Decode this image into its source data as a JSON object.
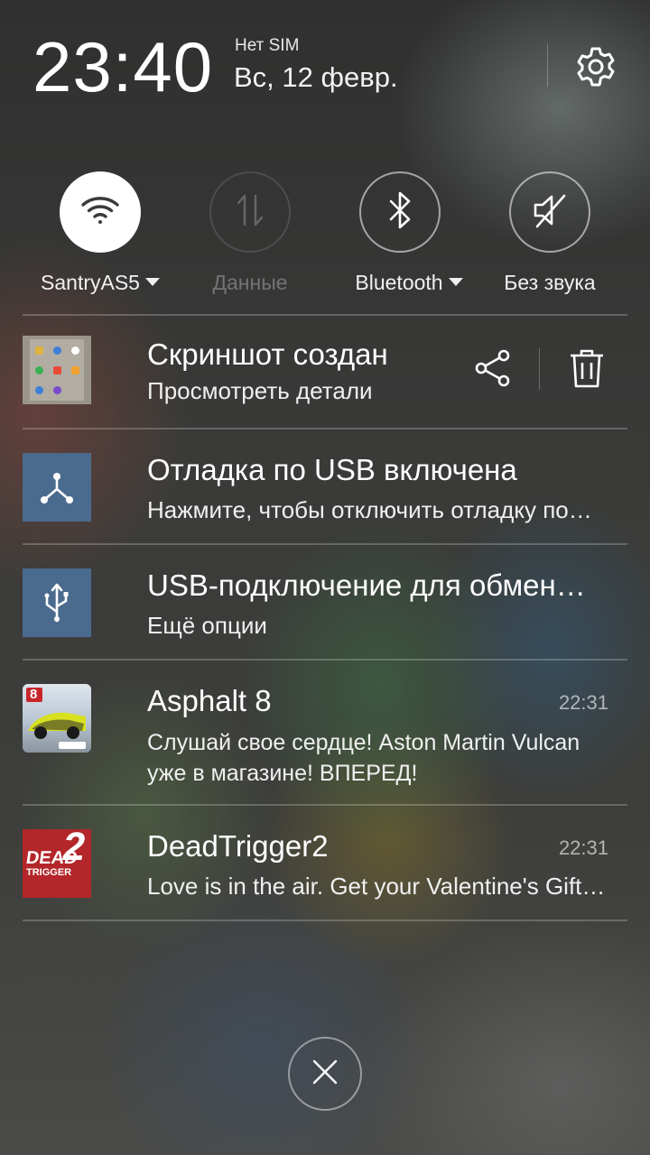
{
  "header": {
    "time": "23:40",
    "sim_status": "Нет SIM",
    "date": "Вс, 12 февр."
  },
  "toggles": [
    {
      "label": "SantryAS5",
      "icon": "wifi-icon",
      "state": "on",
      "has_menu": true
    },
    {
      "label": "Данные",
      "icon": "data-transfer-icon",
      "state": "disabled",
      "has_menu": false
    },
    {
      "label": "Bluetooth",
      "icon": "bluetooth-icon",
      "state": "off",
      "has_menu": true
    },
    {
      "label": "Без звука",
      "icon": "mute-icon",
      "state": "off",
      "has_menu": false
    }
  ],
  "notifications": [
    {
      "id": "screenshot",
      "title": "Скриншот создан",
      "subtitle": "Просмотреть детали",
      "actions": [
        "share-icon",
        "trash-icon"
      ]
    },
    {
      "id": "usb-debug",
      "title": "Отладка по USB включена",
      "subtitle": "Нажмите, чтобы отключить отладку по USB."
    },
    {
      "id": "usb-connection",
      "title": "USB-подключение для обмена файлами",
      "subtitle": "Ещё опции"
    },
    {
      "id": "asphalt",
      "title": "Asphalt 8",
      "time": "22:31",
      "body": "Слушай свое сердце! Aston Martin Vulcan уже в магазине! ВПЕРЕД!"
    },
    {
      "id": "deadtrigger",
      "title": "DeadTrigger2",
      "time": "22:31",
      "subtitle": "Love is in the air. Get your Valentine's Gift now!"
    }
  ],
  "app_icons": {
    "asphalt_badge": "8",
    "deadtrigger_logo": [
      "DEAD",
      "TRIGGER",
      "2"
    ]
  },
  "colors": {
    "usb_icon_bg": "#4a6b8e",
    "deadtrigger_bg": "#b3262a"
  }
}
